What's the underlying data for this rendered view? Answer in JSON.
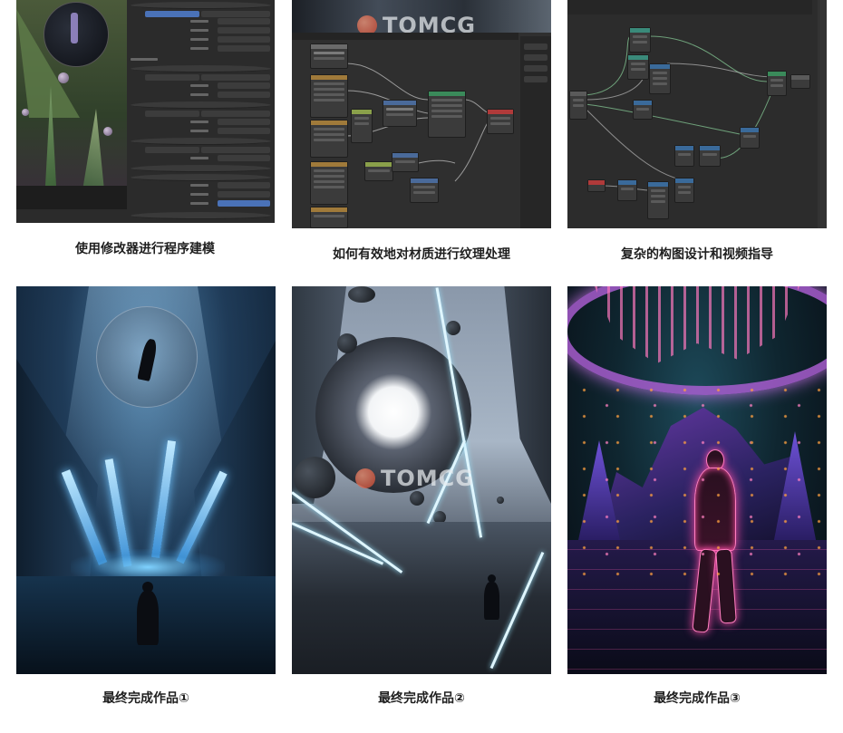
{
  "captions": {
    "tile1": "使用修改器进行程序建模",
    "tile2": "如何有效地对材质进行纹理处理",
    "tile3": "复杂的构图设计和视频指导",
    "tile4": "最终完成作品①",
    "tile5": "最终完成作品②",
    "tile6": "最终完成作品③"
  },
  "watermark": "TOMCG",
  "colors": {
    "ui_dark": "#2b2b2b",
    "ui_blue": "#4a72b8",
    "render1_blue": "#2f5d8c",
    "render3_pink": "#ff4fa8"
  }
}
